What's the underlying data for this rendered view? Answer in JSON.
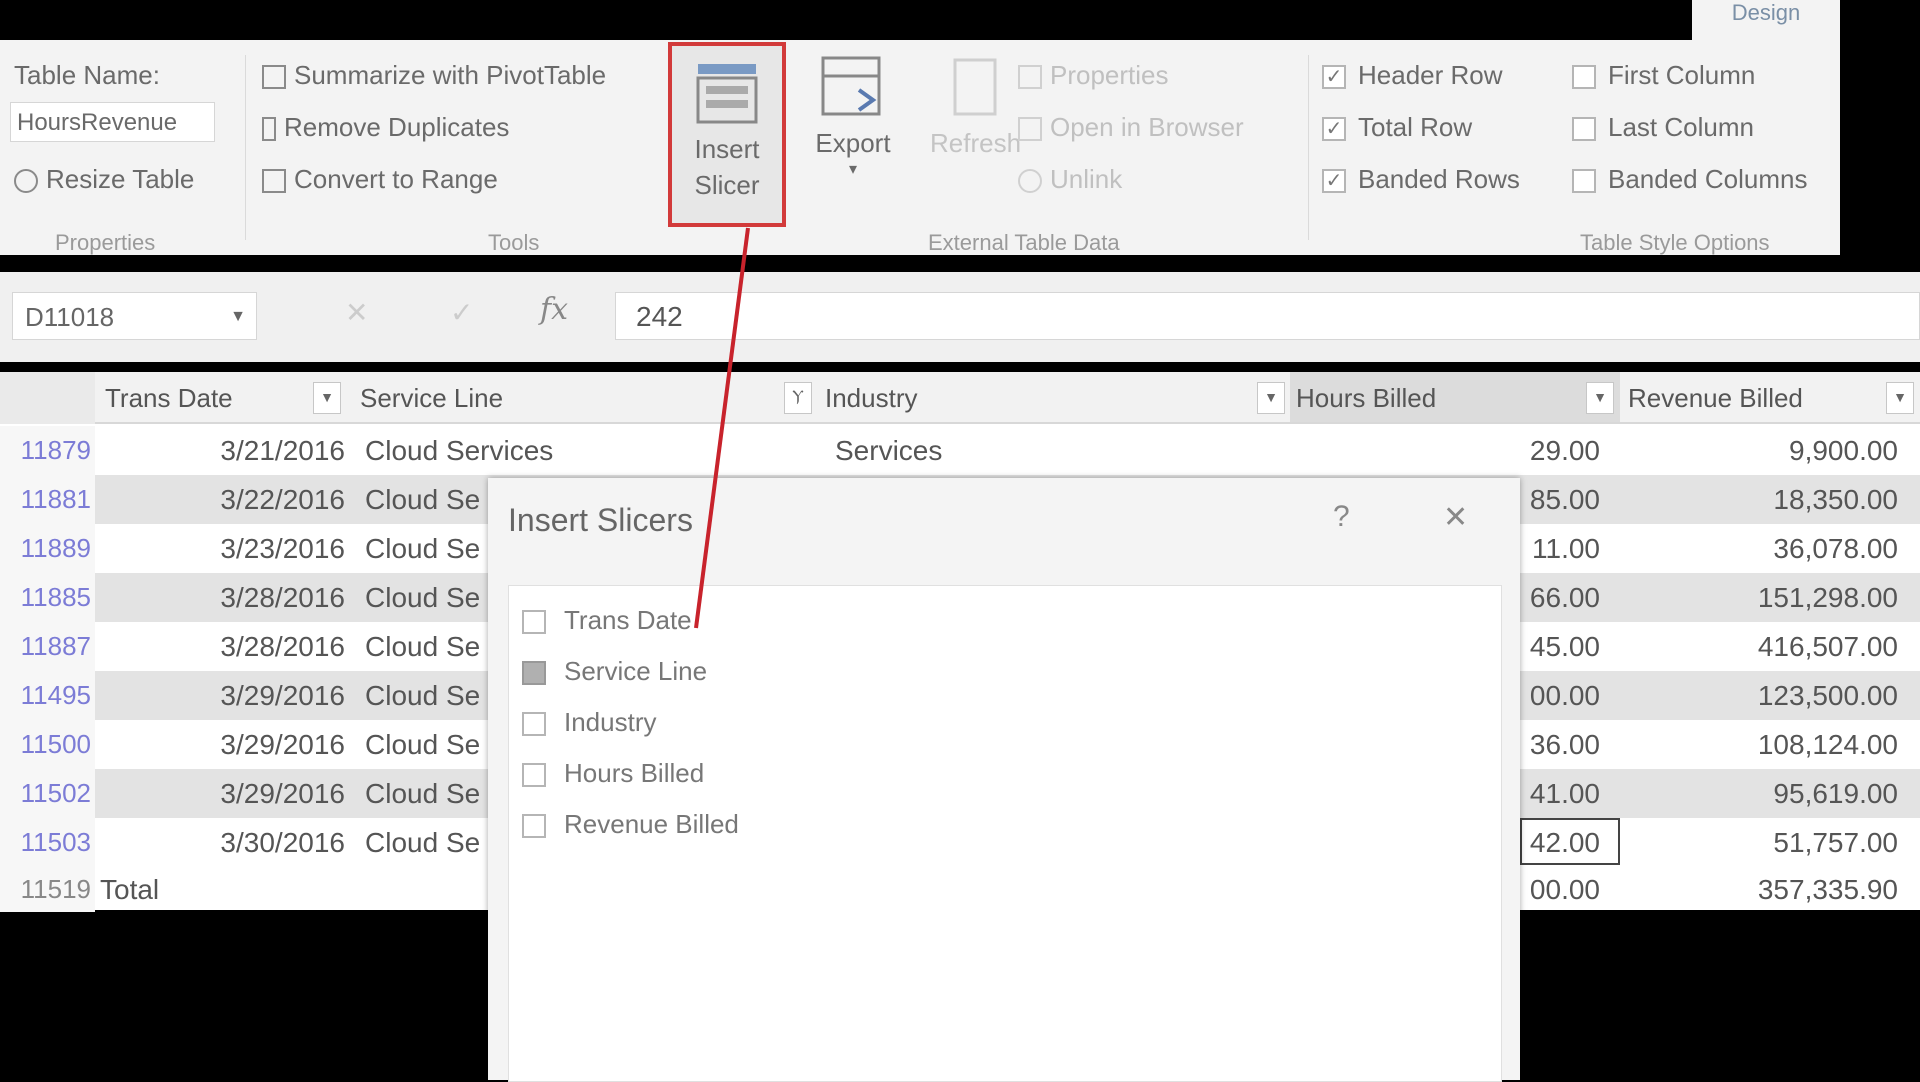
{
  "ribbon": {
    "tab_label": "Design",
    "table_name_label": "Table Name:",
    "table_name_value": "HoursRevenue",
    "resize_table": "Resize Table",
    "summarize_pivot": "Summarize with PivotTable",
    "remove_duplicates": "Remove Duplicates",
    "convert_to_range": "Convert to Range",
    "insert_slicer": "Insert Slicer",
    "export": "Export",
    "refresh": "Refresh",
    "properties": "Properties",
    "open_in_browser": "Open in Browser",
    "unlink": "Unlink",
    "header_row": "Header Row",
    "total_row": "Total Row",
    "banded_rows": "Banded Rows",
    "first_column": "First Column",
    "last_column": "Last Column",
    "banded_columns": "Banded Columns",
    "header_row_checked": true,
    "total_row_checked": true,
    "banded_rows_checked": true,
    "first_column_checked": false,
    "last_column_checked": false,
    "banded_columns_checked": false,
    "groups": {
      "properties": "Properties",
      "tools": "Tools",
      "external": "External Table Data",
      "style_options": "Table Style Options"
    }
  },
  "formula_bar": {
    "name_box": "D11018",
    "value": "242"
  },
  "table": {
    "headers": [
      "Trans Date",
      "Service Line",
      "Industry",
      "Hours Billed",
      "Revenue Billed"
    ],
    "rows": [
      {
        "num": "11879",
        "date": "3/21/2016",
        "service": "Cloud Services",
        "industry": "Services",
        "hours": "29.00",
        "revenue": "9,900.00"
      },
      {
        "num": "11881",
        "date": "3/22/2016",
        "service": "Cloud Se",
        "industry": "",
        "hours": "85.00",
        "revenue": "18,350.00"
      },
      {
        "num": "11889",
        "date": "3/23/2016",
        "service": "Cloud Se",
        "industry": "",
        "hours": "11.00",
        "revenue": "36,078.00"
      },
      {
        "num": "11885",
        "date": "3/28/2016",
        "service": "Cloud Se",
        "industry": "",
        "hours": "66.00",
        "revenue": "151,298.00"
      },
      {
        "num": "11887",
        "date": "3/28/2016",
        "service": "Cloud Se",
        "industry": "",
        "hours": "45.00",
        "revenue": "416,507.00"
      },
      {
        "num": "11495",
        "date": "3/29/2016",
        "service": "Cloud Se",
        "industry": "",
        "hours": "00.00",
        "revenue": "123,500.00"
      },
      {
        "num": "11500",
        "date": "3/29/2016",
        "service": "Cloud Se",
        "industry": "",
        "hours": "36.00",
        "revenue": "108,124.00"
      },
      {
        "num": "11502",
        "date": "3/29/2016",
        "service": "Cloud Se",
        "industry": "",
        "hours": "41.00",
        "revenue": "95,619.00"
      },
      {
        "num": "11503",
        "date": "3/30/2016",
        "service": "Cloud Se",
        "industry": "",
        "hours": "42.00",
        "revenue": "51,757.00"
      }
    ],
    "total_row": {
      "num": "11519",
      "label": "Total",
      "hours": "00.00",
      "revenue": "357,335.90"
    }
  },
  "dialog": {
    "title": "Insert Slicers",
    "help": "?",
    "close": "✕",
    "items": [
      {
        "label": "Trans Date",
        "checked": false
      },
      {
        "label": "Service Line",
        "checked": true
      },
      {
        "label": "Industry",
        "checked": false
      },
      {
        "label": "Hours Billed",
        "checked": false
      },
      {
        "label": "Revenue Billed",
        "checked": false
      }
    ]
  },
  "colors": {
    "highlight": "#d23a3a",
    "link": "#7c7cd6"
  }
}
